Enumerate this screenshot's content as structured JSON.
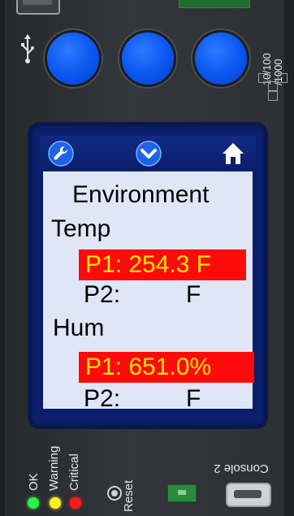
{
  "device": {
    "speed_label": "10/100\n/1000",
    "usb_icon": "usb-icon"
  },
  "lcd": {
    "icons": [
      "wrench-icon",
      "chevron-down-icon",
      "home-icon"
    ],
    "title": "Environment",
    "temp": {
      "label": "Temp",
      "p1": "P1: 254.3 F",
      "p2_label": "P2:",
      "p2_unit": "F"
    },
    "hum": {
      "label": "Hum",
      "p1": "P1: 651.0%",
      "p2_label": "P2:",
      "p2_unit": "F"
    },
    "colors": {
      "alarm_bg": "#ff0a0a",
      "alarm_text": "#ffe600",
      "screen_bg": "#dfe7f6",
      "frame": "#0c1f6b"
    }
  },
  "status": {
    "ok": "OK",
    "warning": "Warning",
    "critical": "Critical",
    "reset": "Reset",
    "console": "Console 2",
    "led_colors": {
      "ok": "#2ef04a",
      "warning": "#ffee22",
      "critical": "#ff1a1a"
    }
  },
  "buttons": {
    "round_button_color": "#0a55f0"
  }
}
